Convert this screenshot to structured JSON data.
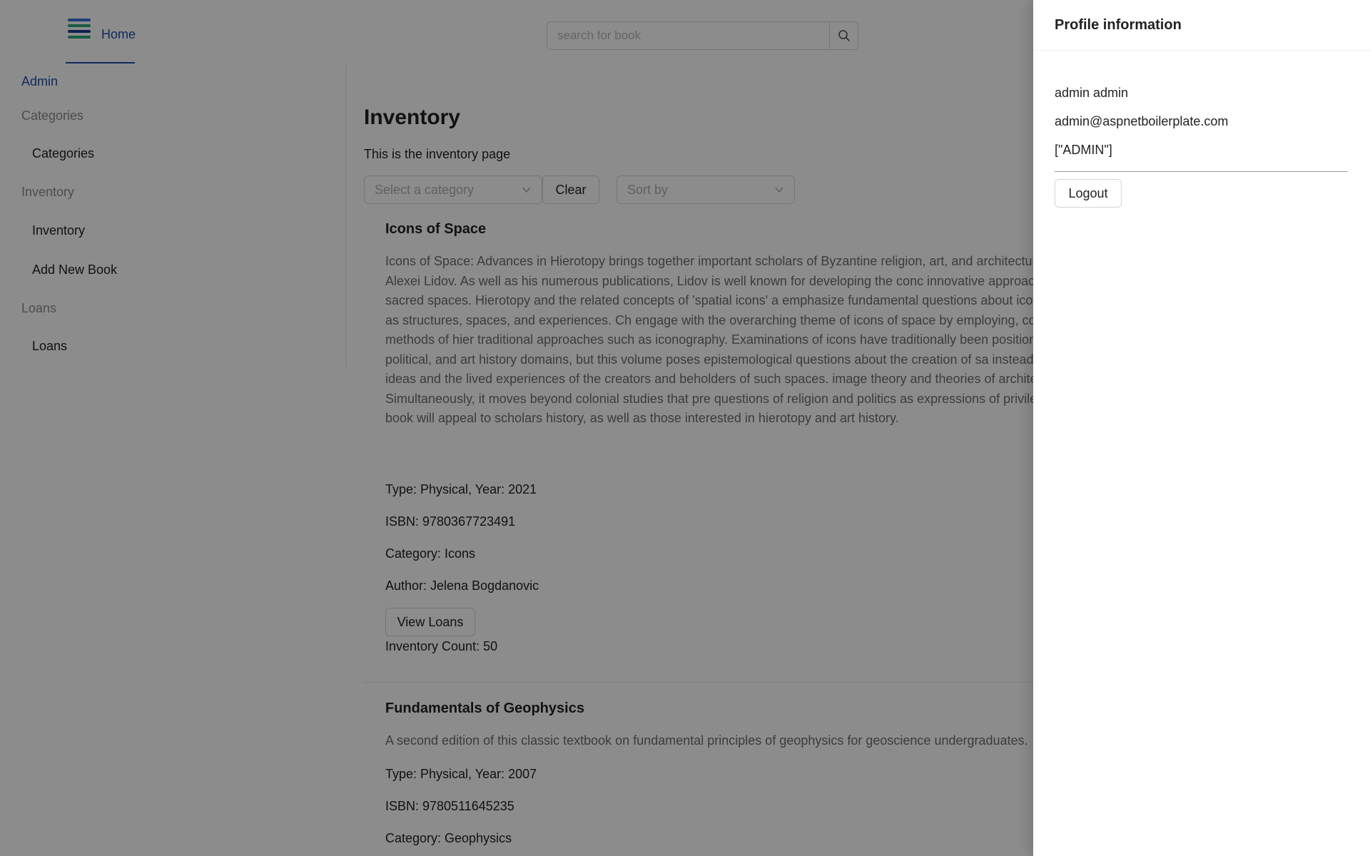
{
  "header": {
    "home_label": "Home",
    "search_placeholder": "search for book",
    "logo_colors": [
      "#3b6fd8",
      "#2aa87a",
      "#1b3f8f",
      "#2aa87a"
    ]
  },
  "sidebar": {
    "root_label": "Admin",
    "groups": [
      {
        "label": "Categories",
        "items": [
          "Categories"
        ]
      },
      {
        "label": "Inventory",
        "items": [
          "Inventory",
          "Add New Book"
        ]
      },
      {
        "label": "Loans",
        "items": [
          "Loans"
        ]
      }
    ]
  },
  "main": {
    "title": "Inventory",
    "subtitle": "This is the inventory page",
    "category_placeholder": "Select a category",
    "clear_label": "Clear",
    "sort_placeholder": "Sort by",
    "books": [
      {
        "title": "Icons of Space",
        "description": "Icons of Space: Advances in Hierotopy brings together important scholars of Byzantine religion, art, and architecture, t renowned art historian Alexei Lidov. As well as his numerous publications, Lidov is well known for developing the conc innovative approach for studying the creation of sacred spaces. Hierotopy and the related concepts of 'spatial icons' a emphasize fundamental questions about icons, including what defines them as structures, spaces, and experiences. Ch engage with the overarching theme of icons of space by employing, contrasting, and complementing methods of hier traditional approaches such as iconography. Examinations of icons have traditionally been positioned within strictly his economic, political, and art history domains, but this volume poses epistemological questions about the creation of sa instead inclusive of multi-layered iconic ideas and the lived experiences of the creators and beholders of such spaces. image theory and theories of architecture and sacred space. Simultaneously, it moves beyond colonial studies that pre questions of religion and politics as expressions of privileged knowledge and power. This book will appeal to scholars history, as well as those interested in hierotopy and art history.",
        "type_year": "Type: Physical, Year: 2021",
        "isbn": "ISBN: 9780367723491",
        "category": "Category: Icons",
        "author": "Author: Jelena Bogdanovic",
        "view_loans": "View Loans",
        "inventory_count": "Inventory Count: 50"
      },
      {
        "title": "Fundamentals of Geophysics",
        "description": "A second edition of this classic textbook on fundamental principles of geophysics for geoscience undergraduates.",
        "type_year": "Type: Physical, Year: 2007",
        "isbn": "ISBN: 9780511645235",
        "category": "Category: Geophysics"
      }
    ]
  },
  "profile": {
    "title": "Profile information",
    "name": "admin admin",
    "email": "admin@aspnetboilerplate.com",
    "roles": "[\"ADMIN\"]",
    "logout_label": "Logout"
  }
}
